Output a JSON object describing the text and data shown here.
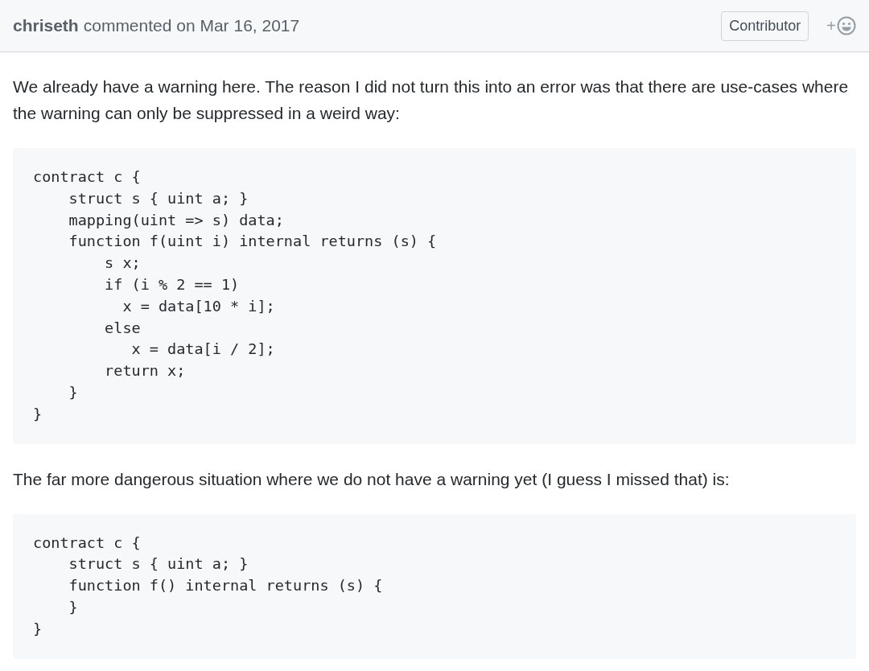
{
  "comment": {
    "author": "chriseth",
    "action": "commented on Mar 16, 2017",
    "badge": "Contributor",
    "reaction_button": "+",
    "body": [
      {
        "kind": "paragraph",
        "text": "We already have a warning here. The reason I did not turn this into an error was that there are use-cases where the warning can only be suppressed in a weird way:"
      },
      {
        "kind": "code",
        "lines": [
          "contract c {",
          "    struct s { uint a; }",
          "    mapping(uint => s) data;",
          "    function f(uint i) internal returns (s) {",
          "        s x;",
          "        if (i % 2 == 1)",
          "          x = data[10 * i];",
          "        else",
          "           x = data[i / 2];",
          "        return x;",
          "    }",
          "}"
        ]
      },
      {
        "kind": "paragraph",
        "text": "The far more dangerous situation where we do not have a warning yet (I guess I missed that) is:"
      },
      {
        "kind": "code",
        "lines": [
          "contract c {",
          "    struct s { uint a; }",
          "    function f() internal returns (s) {",
          "    }",
          "}"
        ]
      }
    ]
  }
}
